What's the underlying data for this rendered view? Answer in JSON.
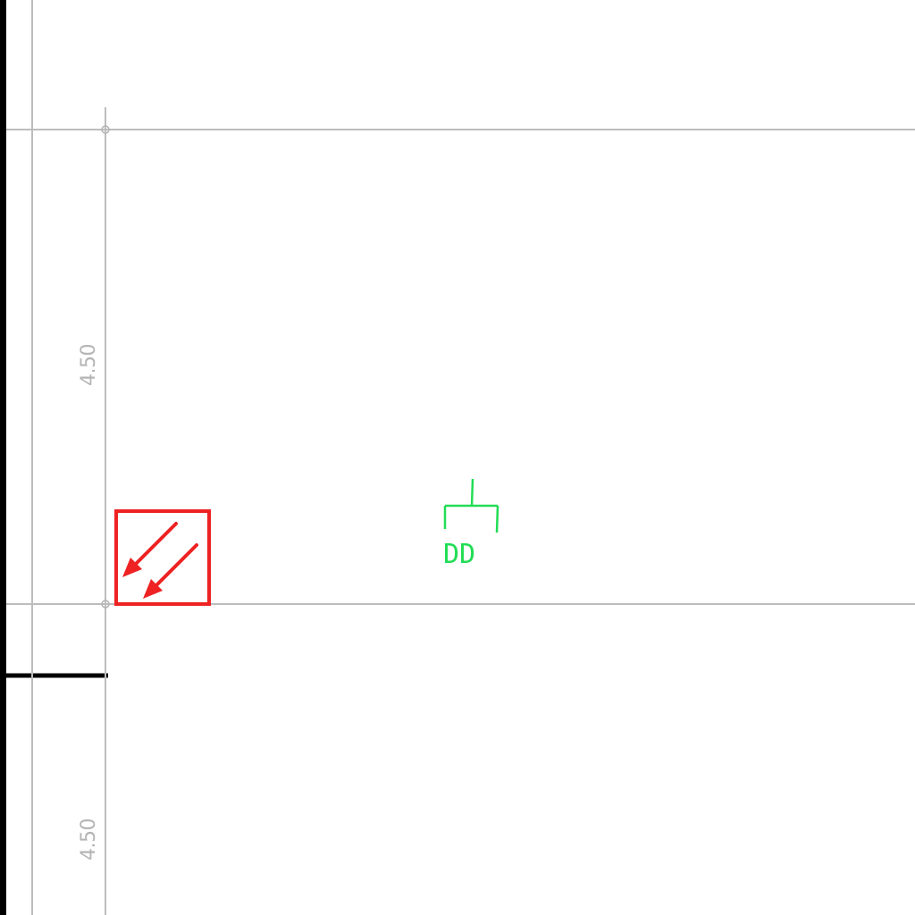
{
  "drawing": {
    "dimensions": [
      "4.50",
      "4.50"
    ],
    "fixture_label": "DD",
    "colors": {
      "background": "#ffffff",
      "grid": "#b4b4b4",
      "wall": "#000000",
      "accent_red": "#ee2222",
      "fixture_green": "#22dd55"
    },
    "icons": [
      "double-arrow-icon",
      "fixture-symbol-icon"
    ]
  }
}
